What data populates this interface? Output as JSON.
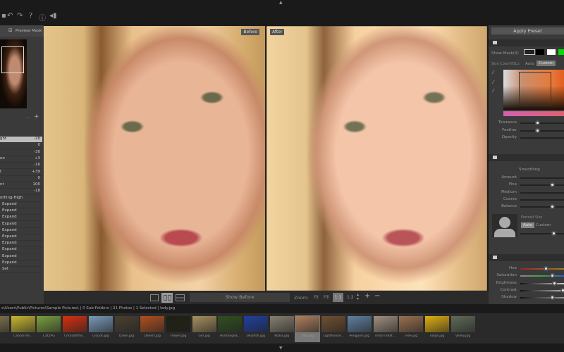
{
  "toolbar": {
    "icons": [
      "undo-icon",
      "redo-icon",
      "help-icon",
      "info-icon",
      "plugin-icon"
    ],
    "help": "?",
    "info": "ⓘ"
  },
  "left_panel": {
    "preview_mask": "Preview Mask",
    "minus": "—",
    "plus": "+",
    "rows": [
      {
        "label": "ght",
        "value": "-20"
      },
      {
        "label": "",
        "value": "0"
      },
      {
        "label": "",
        "value": "-30"
      },
      {
        "label": "on",
        "value": "+3"
      },
      {
        "label": "",
        "value": "-16"
      },
      {
        "label": "t",
        "value": "+39"
      },
      {
        "label": "",
        "value": "0"
      },
      {
        "label": "nt",
        "value": "100"
      },
      {
        "label": "",
        "value": "-18"
      }
    ],
    "preset": "othing-High",
    "expands": [
      "Expand",
      "Expand",
      "Expand",
      "Expand",
      "Expand",
      "Expand",
      "Expand",
      "Expand",
      "Expand",
      "Expand"
    ],
    "set": "Set"
  },
  "view": {
    "before": "Before",
    "after": "After",
    "show_before": "Show Before",
    "zoom": "Zoom:",
    "fit": "Fit",
    "fill": "Fill",
    "one_one": "1:1",
    "one_two": "1:2",
    "plus": "+",
    "minus": "−"
  },
  "right_panel": {
    "apply_preset": "Apply Preset",
    "show_mask": "Show Mask(X)",
    "skin_color": "Skin Color(HSL):",
    "auto": "Auto",
    "custom": "Custom",
    "mask_sliders": [
      {
        "label": "Tolerance",
        "value": 0.4
      },
      {
        "label": "Feather",
        "value": 0.4
      },
      {
        "label": "Opacity",
        "value": null
      }
    ],
    "smoothing": "Smoothing",
    "smooth_sliders": [
      {
        "label": "Amount",
        "value": null
      },
      {
        "label": "Fine",
        "value": 0.75
      },
      {
        "label": "Medium",
        "value": null
      },
      {
        "label": "Coarse",
        "value": null
      },
      {
        "label": "Balance",
        "value": 0.75
      }
    ],
    "portrait_size": "Portrait Size",
    "ps_auto": "Auto",
    "ps_custom": "Custom",
    "ps_value": 0.78,
    "color_sliders": [
      {
        "label": "Hue",
        "value": 0.6
      },
      {
        "label": "Saturation",
        "value": 0.75
      },
      {
        "label": "Brightness",
        "value": 0.8
      },
      {
        "label": "Contrast",
        "value": 1.0
      },
      {
        "label": "Shadow",
        "value": 0.75
      }
    ],
    "colors": {
      "mask_black": "#000000",
      "mask_white": "#ffffff",
      "mask_green": "#00dd00"
    }
  },
  "path_bar": "s\\Users\\Public\\Pictures\\Sample Pictures\\ | 0 Sub-Folders | 21 Photos | 1 Selected | lady.jpg",
  "filmstrip": [
    {
      "name": ".jpg",
      "c": "#8a7a50"
    },
    {
      "name": "Canola fie...",
      "c": "#c8b830"
    },
    {
      "name": "Cat.JPG",
      "c": "#7aa040"
    },
    {
      "name": "Chrysanthe...",
      "c": "#d83010"
    },
    {
      "name": "Clouds.jpg",
      "c": "#7a9ab8"
    },
    {
      "name": "Dawn.jpg",
      "c": "#4a4030"
    },
    {
      "name": "Desert.jpg",
      "c": "#b05020"
    },
    {
      "name": "Flower.jpg",
      "c": "#202010"
    },
    {
      "name": "Girl.jpg",
      "c": "#a89060"
    },
    {
      "name": "Hydrangea...",
      "c": "#305020"
    },
    {
      "name": "Jellyfish.jpg",
      "c": "#2040a0"
    },
    {
      "name": "Koala.jpg",
      "c": "#888070"
    },
    {
      "name": "lady.jpg",
      "c": "#b08060",
      "selected": true
    },
    {
      "name": "Lighthouse...",
      "c": "#705030"
    },
    {
      "name": "Penguins.jpg",
      "c": "#6080a0"
    },
    {
      "name": "small creat...",
      "c": "#a09080"
    },
    {
      "name": "Tree.jpg",
      "c": "#9a7050"
    },
    {
      "name": "Tulips.jpg",
      "c": "#e0b010"
    },
    {
      "name": "Valley.jpg",
      "c": "#606a58"
    }
  ]
}
